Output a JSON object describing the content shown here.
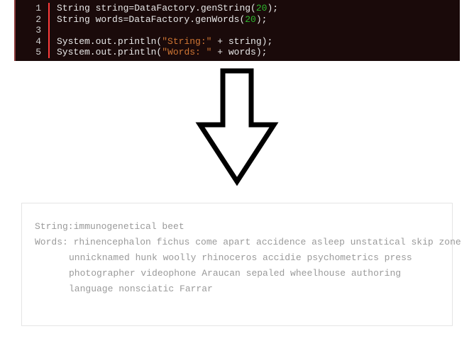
{
  "code": {
    "lines": [
      {
        "num": "1",
        "tokens": [
          {
            "t": "String string=DataFactory.genString(",
            "c": ""
          },
          {
            "t": "20",
            "c": "num"
          },
          {
            "t": ");",
            "c": ""
          }
        ]
      },
      {
        "num": "2",
        "tokens": [
          {
            "t": "String words=DataFactory.genWords(",
            "c": ""
          },
          {
            "t": "20",
            "c": "num"
          },
          {
            "t": ");",
            "c": ""
          }
        ]
      },
      {
        "num": "3",
        "tokens": [
          {
            "t": "",
            "c": ""
          }
        ]
      },
      {
        "num": "4",
        "tokens": [
          {
            "t": "System.out.println(",
            "c": ""
          },
          {
            "t": "\"String:\"",
            "c": "str"
          },
          {
            "t": " + string);",
            "c": ""
          }
        ]
      },
      {
        "num": "5",
        "tokens": [
          {
            "t": "System.out.println(",
            "c": ""
          },
          {
            "t": "\"Words: \"",
            "c": "str"
          },
          {
            "t": " + words);",
            "c": ""
          }
        ]
      }
    ]
  },
  "output": {
    "line1_label": "String:",
    "line1_value": "immunogenetical beet",
    "line2_label": "Words: ",
    "line2_value": "rhinencephalon fichus come apart accidence asleep unstatical skip zone",
    "line3_value": "unnicknamed hunk woolly rhinoceros accidie psychometrics press",
    "line4_value": "photographer videophone Araucan sepaled wheelhouse authoring",
    "line5_value": "language nonsciatic Farrar"
  }
}
